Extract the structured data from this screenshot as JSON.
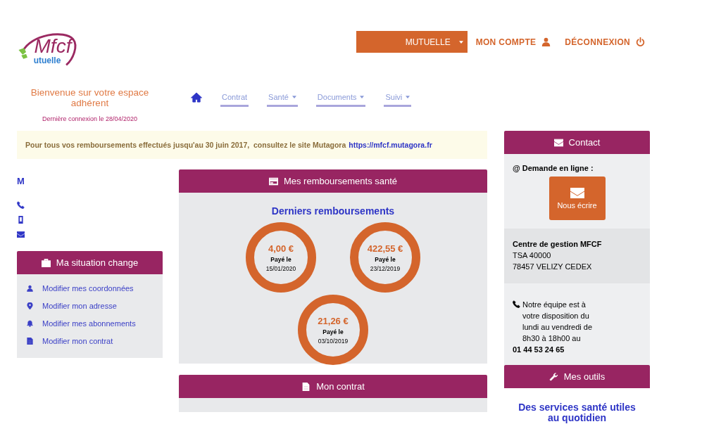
{
  "logo": {
    "main": "Mfcf",
    "sub": "utuelle"
  },
  "top_menu": {
    "dropdown": {
      "label": "MUTUELLE"
    },
    "links": [
      {
        "label": "MON COMPTE",
        "kind": "user"
      },
      {
        "label": "DÉCONNEXION",
        "kind": "power"
      }
    ]
  },
  "welcome": {
    "title": "Bienvenue sur votre espace adhérent",
    "last_login": "Dernière connexion le 28/04/2020"
  },
  "nav": [
    {
      "kind": "home"
    },
    {
      "kind": "link",
      "label": "Contrat",
      "dropdown": false
    },
    {
      "kind": "link",
      "label": "Santé",
      "dropdown": true
    },
    {
      "kind": "link",
      "label": "Documents",
      "dropdown": true
    },
    {
      "kind": "link",
      "label": "Suivi",
      "dropdown": true
    }
  ],
  "notice": {
    "text": "Pour tous vos remboursements effectués jusqu'au 30 juin 2017,  consultez le site Mutagora",
    "link": "https://mfcf.mutagora.fr"
  },
  "member": {
    "initial": "M",
    "contacts": [
      {
        "kind": "phone"
      },
      {
        "kind": "mobile"
      },
      {
        "kind": "mail"
      }
    ]
  },
  "situation": {
    "title": "Ma situation change",
    "items": [
      {
        "kind": "user",
        "label": "Modifier mes coordonnées"
      },
      {
        "kind": "pin",
        "label": "Modifier mon adresse"
      },
      {
        "kind": "bell",
        "label": "Modifier mes abonnements"
      },
      {
        "kind": "file",
        "label": "Modifier mon contrat"
      }
    ]
  },
  "reimbursements": {
    "title": "Mes remboursements santé",
    "subtitle": "Derniers remboursements",
    "items": [
      {
        "amount": "4,00 €",
        "label": "Payé le",
        "date": "15/01/2020"
      },
      {
        "amount": "422,55 €",
        "label": "Payé le",
        "date": "23/12/2019"
      },
      {
        "amount": "21,26 €",
        "label": "Payé le",
        "date": "03/10/2019"
      }
    ]
  },
  "contract": {
    "title": "Mon contrat"
  },
  "contact": {
    "title": "Contact",
    "online_label": "@ Demande en ligne :",
    "write_button": "Nous écrire",
    "address": [
      "Centre de gestion MFCF",
      "TSA 40000",
      "78457 VELIZY CEDEX"
    ],
    "hours": "Notre équipe est à votre disposition du lundi au vendredi de 8h30 à 18h00 au",
    "phone": "01 44 53 24 65"
  },
  "tools": {
    "title": "Mes outils",
    "subtitle": "Des services santé utiles au quotidien"
  }
}
